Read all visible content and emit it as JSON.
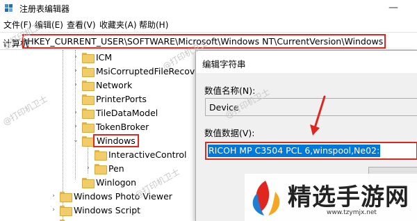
{
  "window": {
    "title": "注册表编辑器",
    "minimize": "—"
  },
  "menu": [
    "文件(F)",
    "编辑(E)",
    "查看(V)",
    "收藏夹(A)",
    "帮助(H)"
  ],
  "address": {
    "prefix": "计算机",
    "path": "\\HKEY_CURRENT_USER\\SOFTWARE\\Microsoft\\Windows NT\\CurrentVersion\\Windows"
  },
  "tree": {
    "items": [
      {
        "label": "ICM",
        "expanded": false
      },
      {
        "label": "MsiCorruptedFileRecover",
        "expanded": false
      },
      {
        "label": "Network",
        "expanded": false
      },
      {
        "label": "PrinterPorts",
        "expanded": false
      },
      {
        "label": "TileDataModel",
        "expanded": false
      },
      {
        "label": "TokenBroker",
        "expanded": false
      },
      {
        "label": "Windows",
        "expanded": true,
        "selected": true
      },
      {
        "label": "InteractiveControl",
        "expanded": false
      },
      {
        "label": "Pen",
        "expanded": false
      },
      {
        "label": "Winlogon",
        "expanded": false
      },
      {
        "label": "Windows Photo Viewer",
        "expanded": false
      },
      {
        "label": "Windows Script",
        "expanded": false
      }
    ]
  },
  "dialog": {
    "title": "编辑字符串",
    "name_label": "数值名称(N):",
    "name_value": "Device",
    "data_label": "数值数据(V):",
    "data_value": "RICOH MP C3504 PCL 6,winspool,Ne02:"
  },
  "watermarks": [
    "@打印机卫士",
    "@打印机卫士",
    "@打印机卫士",
    "@打印机卫士",
    "@打印机卫士"
  ],
  "brand": {
    "name": "精选手游网",
    "url": "www.tzymjx.net"
  },
  "colors": {
    "highlight_red": "#e0271f",
    "selection_blue": "#0078d7",
    "folder_yellow": "#f0cc6a"
  }
}
